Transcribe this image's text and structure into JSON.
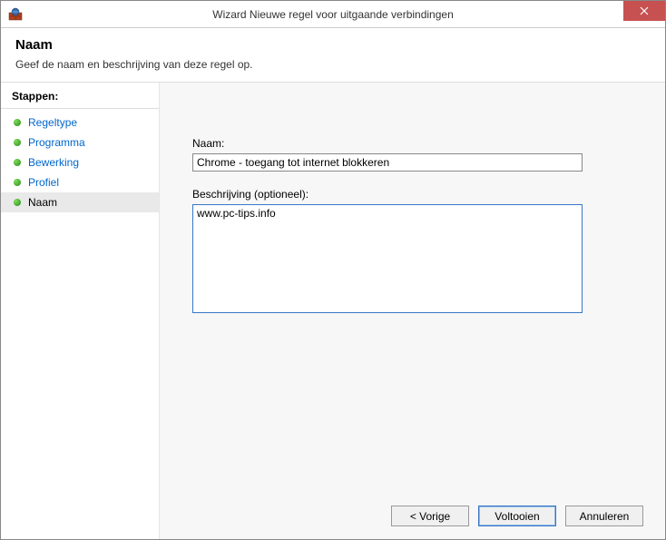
{
  "titlebar": {
    "title": "Wizard Nieuwe regel voor uitgaande verbindingen"
  },
  "header": {
    "title": "Naam",
    "subtitle": "Geef de naam en beschrijving van deze regel op."
  },
  "sidebar": {
    "heading": "Stappen:",
    "items": [
      {
        "label": "Regeltype"
      },
      {
        "label": "Programma"
      },
      {
        "label": "Bewerking"
      },
      {
        "label": "Profiel"
      },
      {
        "label": "Naam"
      }
    ]
  },
  "form": {
    "name_label": "Naam:",
    "name_value": "Chrome - toegang tot internet blokkeren",
    "desc_label": "Beschrijving (optioneel):",
    "desc_value": "www.pc-tips.info"
  },
  "buttons": {
    "back": "< Vorige",
    "finish": "Voltooien",
    "cancel": "Annuleren"
  }
}
